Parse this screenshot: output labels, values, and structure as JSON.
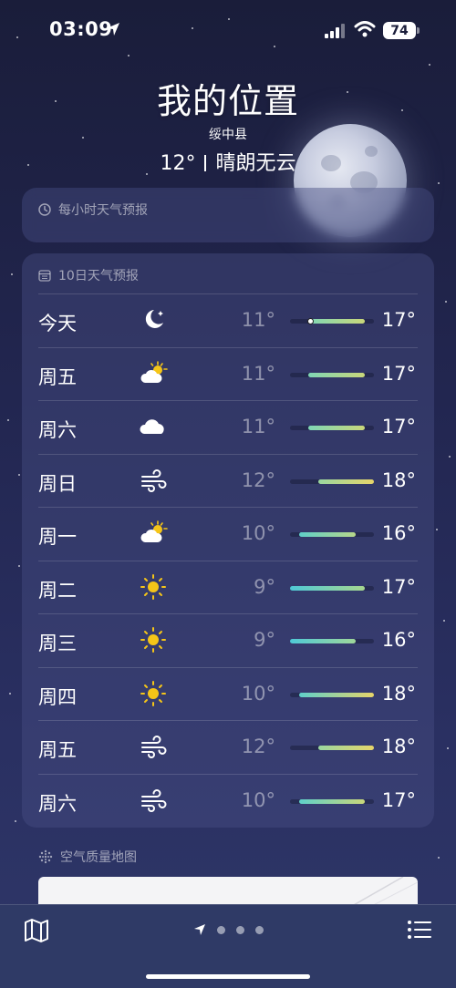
{
  "status_bar": {
    "time": "03:09",
    "battery": "74"
  },
  "header": {
    "location": "我的位置",
    "county": "绥中县",
    "temperature": "12°",
    "condition": "晴朗无云"
  },
  "hourly": {
    "title": "每小时天气预报"
  },
  "forecast": {
    "title": "10日天气预报",
    "range_min": 9,
    "range_max": 18,
    "days": [
      {
        "day": "今天",
        "icon": "moon-stars-icon",
        "low": "11°",
        "high": "17°",
        "low_value": 11,
        "high_value": 17,
        "current_value": 11.2,
        "bar_colors": [
          "#7fd7b5",
          "#c9d77a"
        ]
      },
      {
        "day": "周五",
        "icon": "sun-behind-cloud-icon",
        "low": "11°",
        "high": "17°",
        "low_value": 11,
        "high_value": 17,
        "bar_colors": [
          "#7fd7b5",
          "#c9d77a"
        ]
      },
      {
        "day": "周六",
        "icon": "cloud-icon",
        "low": "11°",
        "high": "17°",
        "low_value": 11,
        "high_value": 17,
        "bar_colors": [
          "#7fd7b5",
          "#c9d77a"
        ]
      },
      {
        "day": "周日",
        "icon": "wind-icon",
        "low": "12°",
        "high": "18°",
        "low_value": 12,
        "high_value": 18,
        "bar_colors": [
          "#9ad7a0",
          "#e6d56a"
        ]
      },
      {
        "day": "周一",
        "icon": "sun-behind-cloud-icon",
        "low": "10°",
        "high": "16°",
        "low_value": 10,
        "high_value": 16,
        "bar_colors": [
          "#5fd0c9",
          "#b7d78a"
        ]
      },
      {
        "day": "周二",
        "icon": "sun-icon",
        "low": "9°",
        "high": "17°",
        "low_value": 9,
        "high_value": 17,
        "bar_colors": [
          "#4fc9d6",
          "#a7d78f"
        ]
      },
      {
        "day": "周三",
        "icon": "sun-icon",
        "low": "9°",
        "high": "16°",
        "low_value": 9,
        "high_value": 16,
        "bar_colors": [
          "#4fc9d6",
          "#9fd79a"
        ]
      },
      {
        "day": "周四",
        "icon": "sun-icon",
        "low": "10°",
        "high": "18°",
        "low_value": 10,
        "high_value": 18,
        "bar_colors": [
          "#5fd0c9",
          "#e6d56a"
        ]
      },
      {
        "day": "周五",
        "icon": "wind-icon",
        "low": "12°",
        "high": "18°",
        "low_value": 12,
        "high_value": 18,
        "bar_colors": [
          "#9ad7a0",
          "#e6d56a"
        ]
      },
      {
        "day": "周六",
        "icon": "wind-icon",
        "low": "10°",
        "high": "17°",
        "low_value": 10,
        "high_value": 17,
        "bar_colors": [
          "#5fd0c9",
          "#c9d77a"
        ]
      }
    ]
  },
  "air_quality": {
    "title": "空气质量地图"
  },
  "bottom_bar": {
    "pages": 3
  }
}
